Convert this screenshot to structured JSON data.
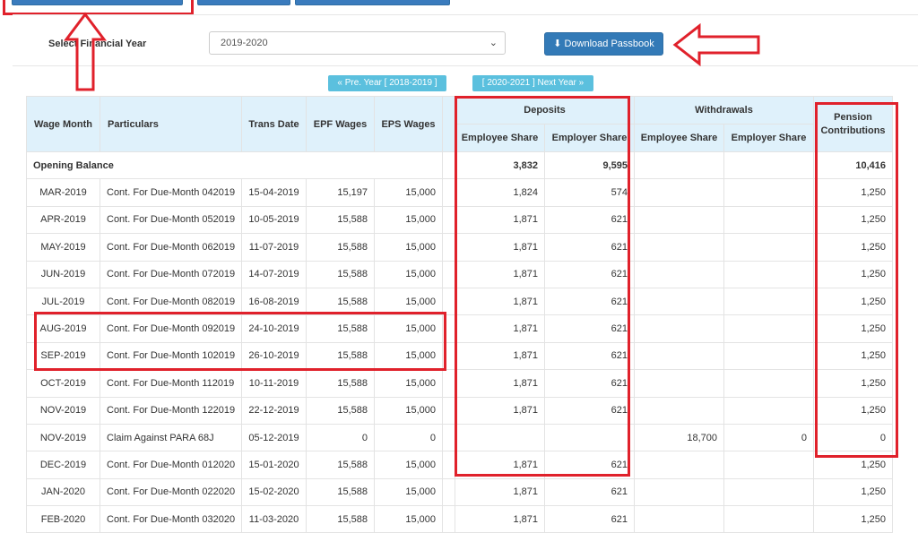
{
  "form": {
    "year_label": "Select Financial Year",
    "year_value": "2019-2020",
    "download_label": "Download Passbook",
    "prev_label": "« Pre. Year [ 2018-2019 ]",
    "next_label": "[ 2020-2021 ] Next Year »"
  },
  "table": {
    "headers": {
      "wage_month": "Wage Month",
      "particulars": "Particulars",
      "trans_date": "Trans Date",
      "epf_wages": "EPF Wages",
      "eps_wages": "EPS Wages",
      "deposits": "Deposits",
      "withdrawals": "Withdrawals",
      "pension": "Pension Contributions",
      "dep_emp": "Employee Share",
      "dep_er": "Employer Share",
      "wd_emp": "Employee Share",
      "wd_er": "Employer Share"
    },
    "opening": {
      "label": "Opening Balance",
      "dep_emp": "3,832",
      "dep_er": "9,595",
      "pension": "10,416"
    },
    "rows": [
      {
        "month": "MAR-2019",
        "part": "Cont. For Due-Month 042019",
        "date": "15-04-2019",
        "epf": "15,197",
        "eps": "15,000",
        "dep_emp": "1,824",
        "dep_er": "574",
        "wd_emp": "",
        "wd_er": "",
        "pension": "1,250"
      },
      {
        "month": "APR-2019",
        "part": "Cont. For Due-Month 052019",
        "date": "10-05-2019",
        "epf": "15,588",
        "eps": "15,000",
        "dep_emp": "1,871",
        "dep_er": "621",
        "wd_emp": "",
        "wd_er": "",
        "pension": "1,250"
      },
      {
        "month": "MAY-2019",
        "part": "Cont. For Due-Month 062019",
        "date": "11-07-2019",
        "epf": "15,588",
        "eps": "15,000",
        "dep_emp": "1,871",
        "dep_er": "621",
        "wd_emp": "",
        "wd_er": "",
        "pension": "1,250"
      },
      {
        "month": "JUN-2019",
        "part": "Cont. For Due-Month 072019",
        "date": "14-07-2019",
        "epf": "15,588",
        "eps": "15,000",
        "dep_emp": "1,871",
        "dep_er": "621",
        "wd_emp": "",
        "wd_er": "",
        "pension": "1,250"
      },
      {
        "month": "JUL-2019",
        "part": "Cont. For Due-Month 082019",
        "date": "16-08-2019",
        "epf": "15,588",
        "eps": "15,000",
        "dep_emp": "1,871",
        "dep_er": "621",
        "wd_emp": "",
        "wd_er": "",
        "pension": "1,250"
      },
      {
        "month": "AUG-2019",
        "part": "Cont. For Due-Month 092019",
        "date": "24-10-2019",
        "epf": "15,588",
        "eps": "15,000",
        "dep_emp": "1,871",
        "dep_er": "621",
        "wd_emp": "",
        "wd_er": "",
        "pension": "1,250"
      },
      {
        "month": "SEP-2019",
        "part": "Cont. For Due-Month 102019",
        "date": "26-10-2019",
        "epf": "15,588",
        "eps": "15,000",
        "dep_emp": "1,871",
        "dep_er": "621",
        "wd_emp": "",
        "wd_er": "",
        "pension": "1,250"
      },
      {
        "month": "OCT-2019",
        "part": "Cont. For Due-Month 112019",
        "date": "10-11-2019",
        "epf": "15,588",
        "eps": "15,000",
        "dep_emp": "1,871",
        "dep_er": "621",
        "wd_emp": "",
        "wd_er": "",
        "pension": "1,250"
      },
      {
        "month": "NOV-2019",
        "part": "Cont. For Due-Month 122019",
        "date": "22-12-2019",
        "epf": "15,588",
        "eps": "15,000",
        "dep_emp": "1,871",
        "dep_er": "621",
        "wd_emp": "",
        "wd_er": "",
        "pension": "1,250"
      },
      {
        "month": "NOV-2019",
        "part": "Claim Against PARA 68J",
        "date": "05-12-2019",
        "epf": "0",
        "eps": "0",
        "dep_emp": "",
        "dep_er": "",
        "wd_emp": "18,700",
        "wd_er": "0",
        "pension": "0"
      },
      {
        "month": "DEC-2019",
        "part": "Cont. For Due-Month 012020",
        "date": "15-01-2020",
        "epf": "15,588",
        "eps": "15,000",
        "dep_emp": "1,871",
        "dep_er": "621",
        "wd_emp": "",
        "wd_er": "",
        "pension": "1,250"
      },
      {
        "month": "JAN-2020",
        "part": "Cont. For Due-Month 022020",
        "date": "15-02-2020",
        "epf": "15,588",
        "eps": "15,000",
        "dep_emp": "1,871",
        "dep_er": "621",
        "wd_emp": "",
        "wd_er": "",
        "pension": "1,250"
      },
      {
        "month": "FEB-2020",
        "part": "Cont. For Due-Month 032020",
        "date": "11-03-2020",
        "epf": "15,588",
        "eps": "15,000",
        "dep_emp": "1,871",
        "dep_er": "621",
        "wd_emp": "",
        "wd_er": "",
        "pension": "1,250"
      }
    ]
  }
}
